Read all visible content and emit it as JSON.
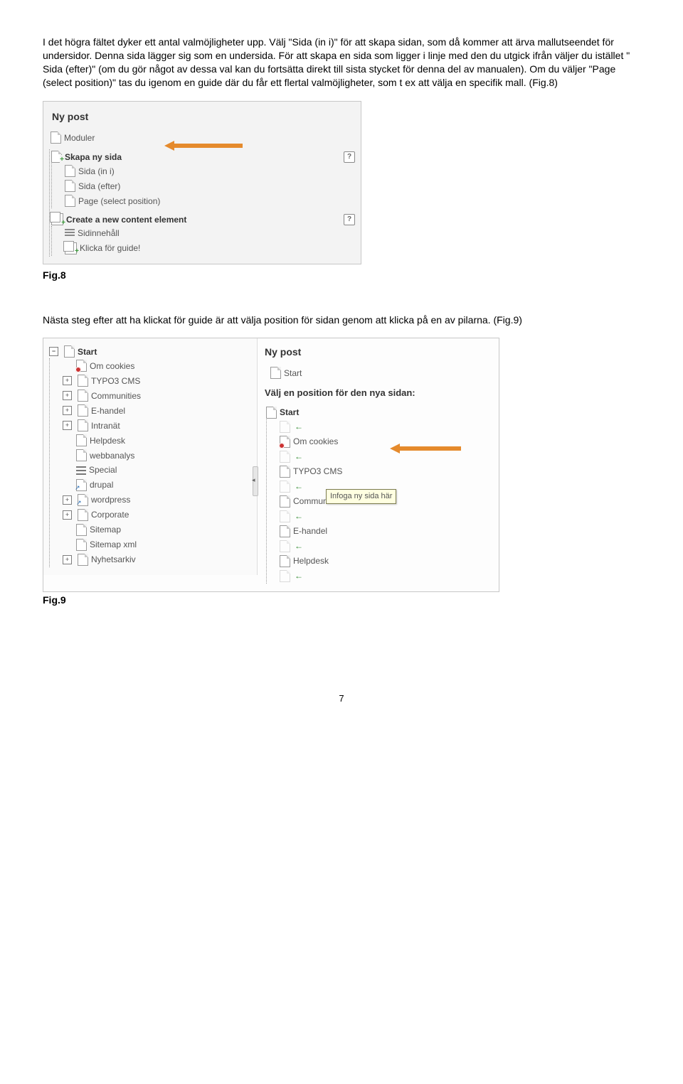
{
  "para1": "I det högra fältet dyker ett antal valmöjligheter upp. Välj \"Sida (in i)\" för att skapa sidan, som då kommer att ärva mallutseendet för undersidor. Denna sida lägger sig som en undersida. För att skapa en sida som ligger i linje med den du utgick ifrån väljer du istället \" Sida (efter)\" (om du gör något av dessa val kan du fortsätta direkt till sista stycket för denna del av manualen). Om du väljer \"Page (select position)\" tas du igenom en guide där du får ett flertal valmöjligheter, som t ex att välja en specifik mall. (Fig.8)",
  "fig8": {
    "title": "Ny post",
    "moduler": "Moduler",
    "skapa": "Skapa ny sida",
    "sida_in_i": "Sida (in i)",
    "sida_efter": "Sida (efter)",
    "page_select": "Page (select position)",
    "create_ce": "Create a new content element",
    "sidinnehall": "Sidinnehåll",
    "klicka_guide": "Klicka för guide!",
    "caption": "Fig.8"
  },
  "para2": "Nästa steg efter att ha klickat för guide är att välja position för sidan genom att klicka på en av pilarna. (Fig.9)",
  "fig9": {
    "left": {
      "start": "Start",
      "items": [
        {
          "label": "Om cookies",
          "icon": "stop",
          "exp": "none"
        },
        {
          "label": "TYPO3 CMS",
          "icon": "page",
          "exp": "plus"
        },
        {
          "label": "Communities",
          "icon": "page",
          "exp": "plus"
        },
        {
          "label": "E-handel",
          "icon": "page",
          "exp": "plus"
        },
        {
          "label": "Intranät",
          "icon": "page",
          "exp": "plus"
        },
        {
          "label": "Helpdesk",
          "icon": "page",
          "exp": "none"
        },
        {
          "label": "webbanalys",
          "icon": "page",
          "exp": "none"
        },
        {
          "label": "Special",
          "icon": "special",
          "exp": "none"
        },
        {
          "label": "drupal",
          "icon": "shortcut",
          "exp": "none"
        },
        {
          "label": "wordpress",
          "icon": "shortcut",
          "exp": "plus"
        },
        {
          "label": "Corporate",
          "icon": "page",
          "exp": "plus"
        },
        {
          "label": "Sitemap",
          "icon": "page",
          "exp": "none"
        },
        {
          "label": "Sitemap xml",
          "icon": "page",
          "exp": "none"
        },
        {
          "label": "Nyhetsarkiv",
          "icon": "page",
          "exp": "plus"
        }
      ]
    },
    "right": {
      "title": "Ny post",
      "start": "Start",
      "subhead": "Välj en position för den nya sidan:",
      "tree_root": "Start",
      "items": [
        {
          "label": "Om cookies",
          "icon": "stop",
          "arrow": false
        },
        {
          "label": "TYPO3 CMS",
          "icon": "page",
          "arrow": false
        },
        {
          "label": "Communities",
          "icon": "page",
          "arrow": true
        },
        {
          "label": "E-handel",
          "icon": "page",
          "arrow": false
        },
        {
          "label": "Helpdesk",
          "icon": "page",
          "arrow": false
        }
      ],
      "tooltip": "Infoga ny sida här"
    },
    "caption": "Fig.9"
  },
  "pagenum": "7"
}
